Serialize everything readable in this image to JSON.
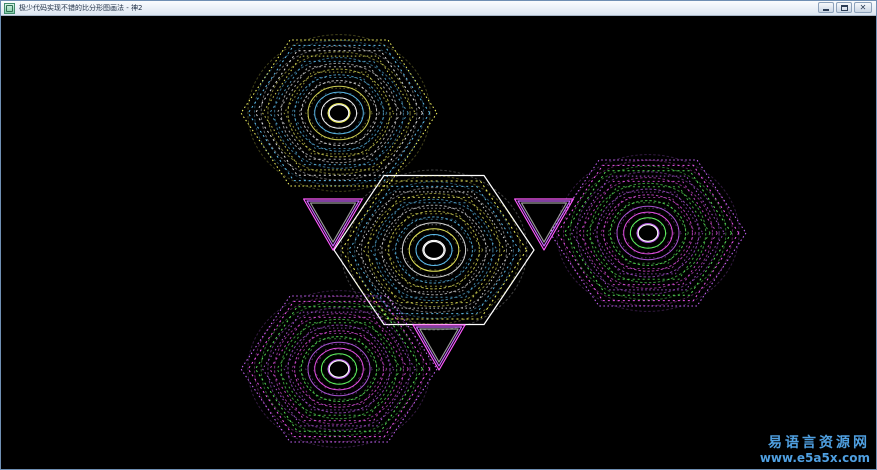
{
  "window": {
    "title": "极少代码实现不错的比分形图画法 - 神2",
    "controls": {
      "minimize_icon": "minimize-icon",
      "maximize_icon": "maximize-icon",
      "close_icon": "close-icon"
    }
  },
  "watermark": {
    "site_name": "易语言资源网",
    "url": "www.e5a5x.com",
    "color": "#4f9fe0"
  },
  "figure": {
    "background": "#000000",
    "colors": [
      "#ffffff",
      "#ff5aff",
      "#ffff66",
      "#66ff66",
      "#66ccff",
      "#cc66ff"
    ]
  }
}
